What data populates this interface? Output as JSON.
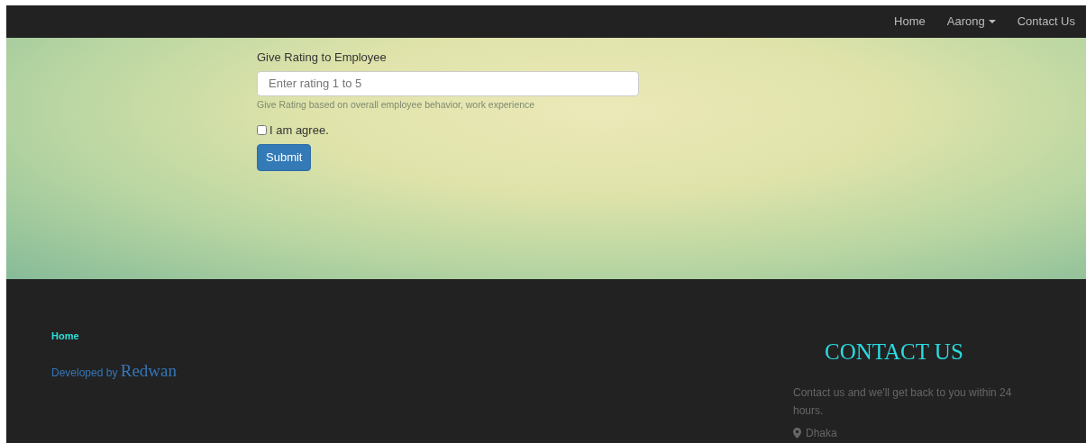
{
  "navbar": {
    "items": [
      {
        "label": "Home",
        "kind": "link"
      },
      {
        "label": "Aarong",
        "kind": "dropdown"
      },
      {
        "label": "Contact Us",
        "kind": "link"
      }
    ]
  },
  "form": {
    "label": "Give Rating to Employee",
    "placeholder": "Enter rating 1 to 5",
    "help": "Give Rating based on overall employee behavior, work experience",
    "agree": {
      "label": "I am agree.",
      "checked": false
    },
    "submit": "Submit"
  },
  "footer": {
    "link": "Home",
    "credit_prefix": "Developed by",
    "credit_name": "Redwan",
    "contact_title": "CONTACT US",
    "contact_text": "Contact us and we'll get back to you within 24 hours.",
    "location": "Dhaka"
  }
}
